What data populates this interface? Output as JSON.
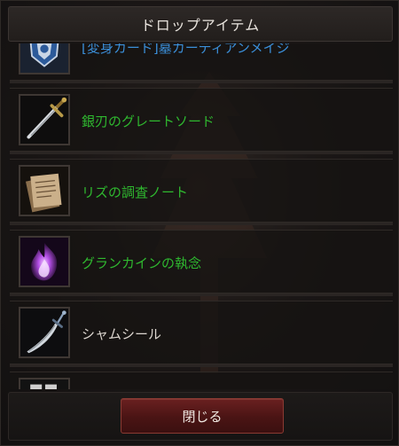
{
  "dialog": {
    "title": "ドロップアイテム",
    "close_label": "閉じる"
  },
  "items": [
    {
      "name": "[変身カード]墓カーディアンメイジ",
      "color": "#3b8fd9",
      "icon": "transformation-card-icon"
    },
    {
      "name": "銀刃のグレートソード",
      "color": "#2fb82f",
      "icon": "greatsword-icon"
    },
    {
      "name": "リズの調査ノート",
      "color": "#2fb82f",
      "icon": "notes-icon"
    },
    {
      "name": "グランカインの執念",
      "color": "#2fb82f",
      "icon": "purple-flame-icon"
    },
    {
      "name": "シャムシール",
      "color": "#dcd6cf",
      "icon": "shamshir-icon"
    },
    {
      "name": "",
      "color": "#dcd6cf",
      "icon": "partial-item-icon"
    }
  ]
}
